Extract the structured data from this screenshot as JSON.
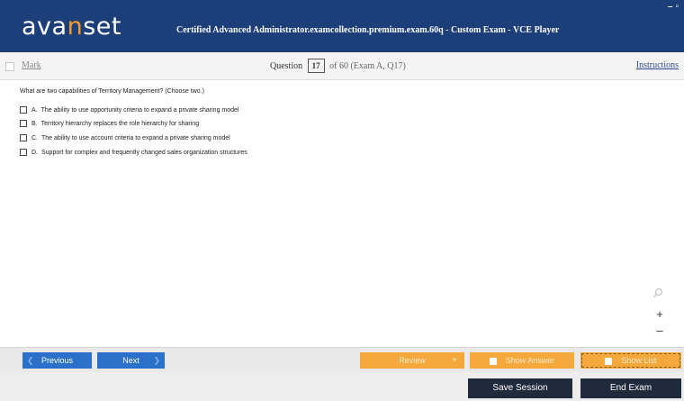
{
  "app": {
    "logo_prefix": "ava",
    "logo_accent": "n",
    "logo_suffix": "set",
    "window_title": "Certified Advanced Administrator.examcollection.premium.exam.60q - Custom Exam - VCE Player",
    "window_controls": [
      "–",
      "▫"
    ]
  },
  "header": {
    "mark_label": "Mark",
    "question_label": "Question",
    "question_number": "17",
    "question_of": "of 60 (Exam A, Q17)",
    "instructions_label": "Instructions"
  },
  "question": {
    "text": "What are two capabilities of Territory Management? (Choose two.)",
    "options": [
      {
        "letter": "A.",
        "text": "The ability to use opportunity criteria to expand a private sharing model"
      },
      {
        "letter": "B.",
        "text": "Territory hierarchy replaces the role hierarchy for sharing"
      },
      {
        "letter": "C.",
        "text": "The ability to use account criteria to expand a private sharing model"
      },
      {
        "letter": "D.",
        "text": "Support for complex and frequently changed sales organization structures"
      }
    ]
  },
  "zoom": {
    "plus": "+",
    "minus": "–",
    "search_icon": "magnifier-icon"
  },
  "nav": {
    "previous_label": "Previous",
    "next_label": "Next",
    "review_label": "Review",
    "show_answer_label": "Show Answer",
    "show_list_label": "Show List"
  },
  "footer": {
    "save_session_label": "Save Session",
    "end_exam_label": "End Exam"
  },
  "colors": {
    "title_bar": "#1c3f7a",
    "logo_accent": "#f39c2b",
    "button_blue": "#2b70c9",
    "button_orange": "#f5a93c",
    "button_dark": "#1f2a3d"
  }
}
